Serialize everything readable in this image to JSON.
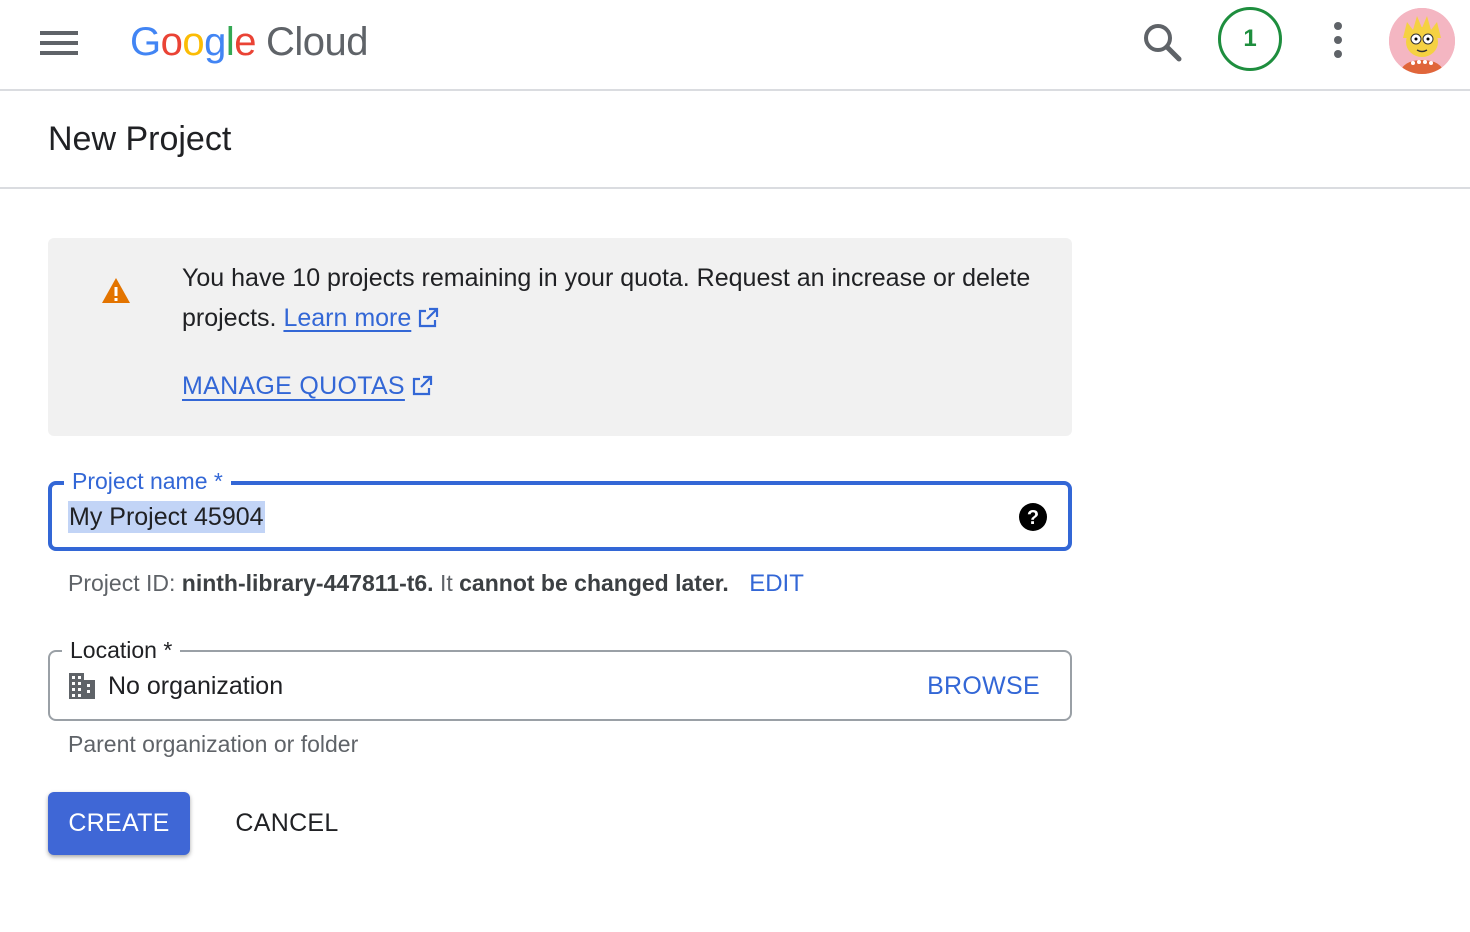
{
  "header": {
    "menu_icon": "hamburger-menu-icon",
    "logo_google": "Google",
    "logo_product": "Cloud",
    "search_icon": "search-icon",
    "notification_count": "1",
    "more_icon": "more-vertical-icon",
    "avatar_icon": "user-avatar"
  },
  "page": {
    "title": "New Project"
  },
  "quota_notice": {
    "icon": "warning-icon",
    "text": "You have 10 projects remaining in your quota. Request an increase or delete projects.",
    "learn_more": "Learn more",
    "manage_quotas": "MANAGE QUOTAS",
    "warning_color": "#e37400",
    "link_color": "#3367d6"
  },
  "project_name_field": {
    "label": "Project name *",
    "value": "My Project 45904",
    "help_icon": "help-icon"
  },
  "project_id_hint": {
    "prefix": "Project ID:",
    "project_id": "ninth-library-447811-t6.",
    "middle": "It",
    "emphasis": "cannot be changed later.",
    "edit_label": "EDIT"
  },
  "location_field": {
    "label": "Location *",
    "value": "No organization",
    "icon": "building-icon",
    "browse_label": "BROWSE",
    "hint": "Parent organization or folder"
  },
  "actions": {
    "create_label": "CREATE",
    "cancel_label": "CANCEL",
    "primary_color": "#3f67d6"
  }
}
